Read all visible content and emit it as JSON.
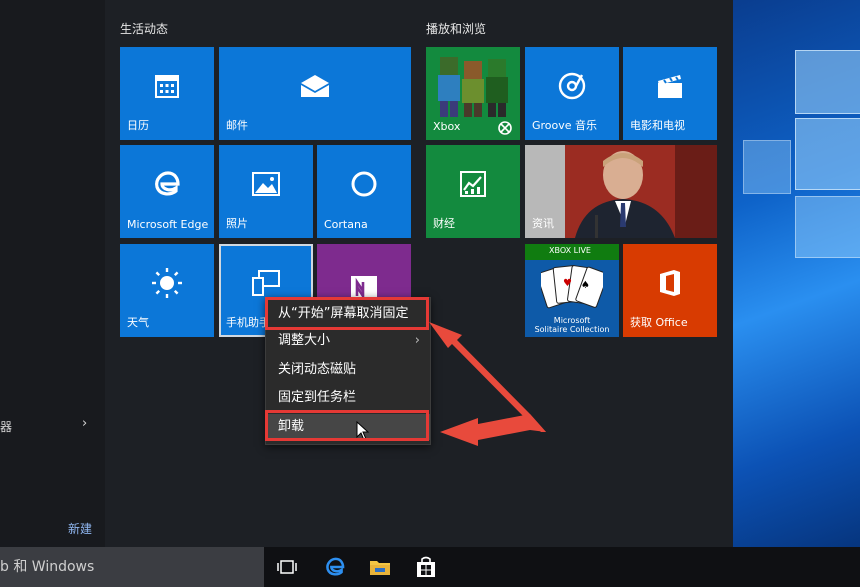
{
  "groups": {
    "life": "生活动态",
    "play": "播放和浏览"
  },
  "tiles": {
    "calendar": "日历",
    "mail": "邮件",
    "edge": "Microsoft Edge",
    "photos": "照片",
    "cortana": "Cortana",
    "weather": "天气",
    "phone": "手机助手",
    "xbox": "Xbox",
    "groove": "Groove 音乐",
    "movies": "电影和电视",
    "finance": "财经",
    "news": "资讯",
    "solitaire_badge": "XBOX LIVE",
    "solitaire_line1": "Microsoft",
    "solitaire_line2": "Solitaire Collection",
    "office": "获取 Office"
  },
  "context_menu": {
    "items": [
      "从“开始”屏幕取消固定",
      "调整大小",
      "关闭动态磁贴",
      "固定到任务栏",
      "卸载"
    ]
  },
  "left": {
    "partial_item": "器",
    "new_label": "新建"
  },
  "taskbar": {
    "search_text": "b 和 Windows"
  },
  "colors": {
    "tile_blue": "#0c77d8",
    "tile_green": "#138a3e",
    "tile_purple": "#7e2b8e",
    "tile_orange": "#d83b01",
    "annotation_red": "#e53935"
  }
}
